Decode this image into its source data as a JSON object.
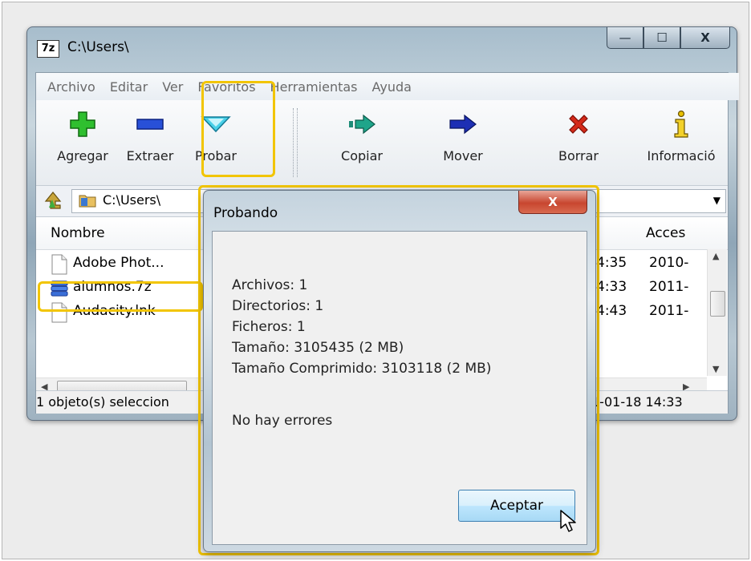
{
  "window": {
    "title": "C:\\Users\\",
    "app_icon_text": "7z",
    "controls": {
      "minimize": "—",
      "maximize": "☐",
      "close": "X"
    }
  },
  "menu": [
    "Archivo",
    "Editar",
    "Ver",
    "Favoritos",
    "Herramientas",
    "Ayuda"
  ],
  "toolbar": {
    "add": "Agregar",
    "extract": "Extraer",
    "test": "Probar",
    "copy": "Copiar",
    "move": "Mover",
    "delete": "Borrar",
    "info": "Informació"
  },
  "address": {
    "path": "C:\\Users\\"
  },
  "columns": {
    "name": "Nombre",
    "accessed": "Acces"
  },
  "files": [
    {
      "name": "Adobe Phot...",
      "time": "4:35",
      "accessed": "2010-"
    },
    {
      "name": "alumnos.7z",
      "time": "4:33",
      "accessed": "2011-"
    },
    {
      "name": "Audacity.lnk",
      "time": "4:43",
      "accessed": "2011-"
    }
  ],
  "status": {
    "left": "1 objeto(s) seleccion",
    "right": "1-01-18 14:33"
  },
  "dialog": {
    "title": "Probando",
    "close": "X",
    "lines": [
      "Archivos: 1",
      "Directorios: 1",
      "Ficheros: 1",
      "Tamaño: 3105435 (2 MB)",
      "Tamaño Comprimido: 3103118 (2 MB)"
    ],
    "message": "No hay errores",
    "ok": "Aceptar"
  },
  "colors": {
    "highlight": "#f2c500",
    "close_red": "#c8462f"
  }
}
